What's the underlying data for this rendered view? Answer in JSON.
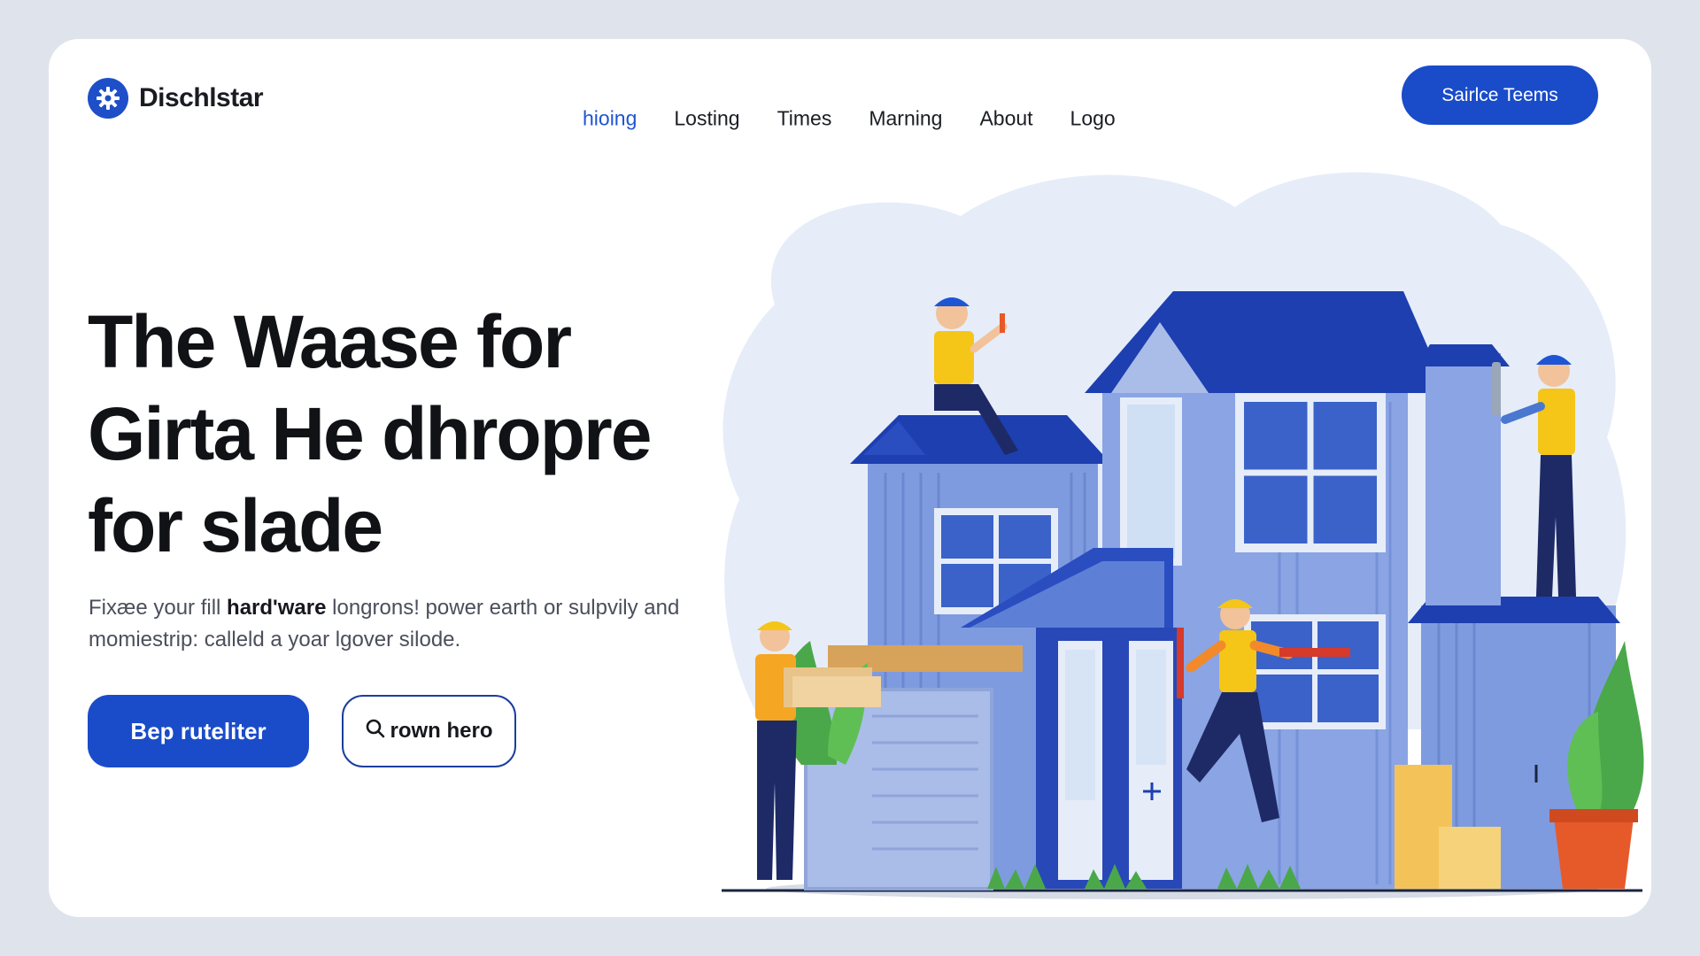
{
  "brand": {
    "name": "Dischlstar",
    "logo_icon": "gear-icon"
  },
  "nav": {
    "items": [
      {
        "label": "hioing",
        "active": true
      },
      {
        "label": "Losting",
        "active": false
      },
      {
        "label": "Times",
        "active": false
      },
      {
        "label": "Marning",
        "active": false
      },
      {
        "label": "About",
        "active": false
      },
      {
        "label": "Logo",
        "active": false
      }
    ]
  },
  "header": {
    "cta_label": "Sairlce Teems"
  },
  "hero": {
    "title_lines": [
      "The Waase for",
      "Girta He dhropre",
      "for slade"
    ],
    "subtitle_pre": "Fixæe your fill ",
    "subtitle_bold": "hard'ware",
    "subtitle_post": " longrons! power earth or sulpvily and momiestrip: calleld a yoar lgover silode.",
    "primary_button": "Bep ruteliter",
    "secondary_button": "rown hero",
    "secondary_icon": "search-icon"
  },
  "colors": {
    "accent": "#1a4cc9",
    "nav_active": "#1e55d4",
    "background": "#dfe4ec",
    "roof": "#1d3fb0",
    "house": "#7f9be0",
    "vest": "#f5c518"
  }
}
